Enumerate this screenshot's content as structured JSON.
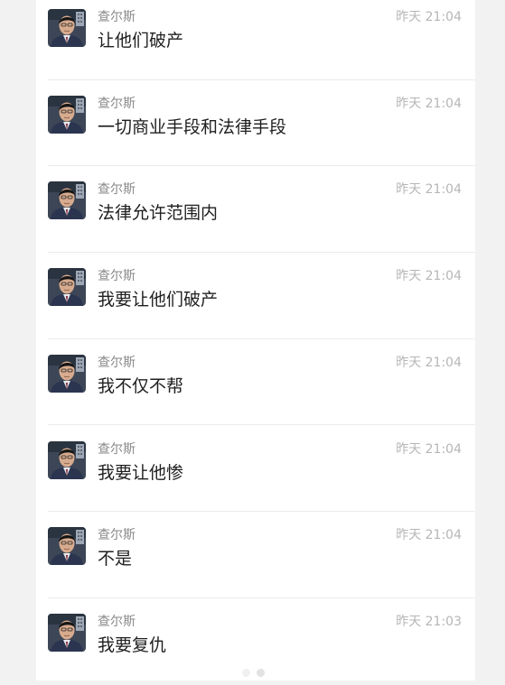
{
  "messages": [
    {
      "sender": "查尔斯",
      "time": "昨天 21:04",
      "text": "让他们破产"
    },
    {
      "sender": "查尔斯",
      "time": "昨天 21:04",
      "text": "一切商业手段和法律手段"
    },
    {
      "sender": "查尔斯",
      "time": "昨天 21:04",
      "text": "法律允许范围内"
    },
    {
      "sender": "查尔斯",
      "time": "昨天 21:04",
      "text": "我要让他们破产"
    },
    {
      "sender": "查尔斯",
      "time": "昨天 21:04",
      "text": "我不仅不帮"
    },
    {
      "sender": "查尔斯",
      "time": "昨天 21:04",
      "text": "我要让他惨"
    },
    {
      "sender": "查尔斯",
      "time": "昨天 21:04",
      "text": "不是"
    },
    {
      "sender": "查尔斯",
      "time": "昨天 21:03",
      "text": "我要复仇"
    }
  ],
  "pager": {
    "count": 2,
    "active": 1
  },
  "colors": {
    "sender": "#8a8a8a",
    "time": "#b6b6b6",
    "text": "#1f1f1f",
    "divider": "#ececec"
  }
}
